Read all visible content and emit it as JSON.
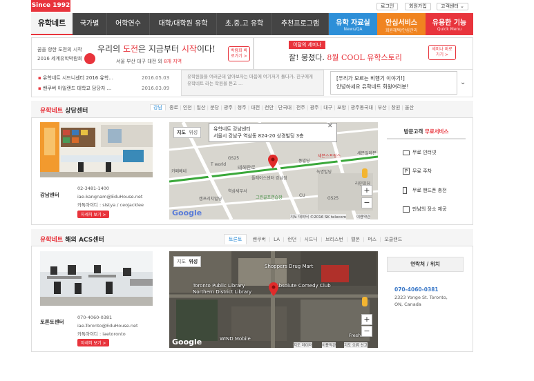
{
  "top": {
    "since": "Since 1992",
    "login": "로그인",
    "join": "회원가입",
    "customer": "고객센터"
  },
  "nav": {
    "logo": "유학네트",
    "items": [
      "국가별",
      "어학연수",
      "대학/대학원 유학",
      "초.중.고 유학",
      "추천프로그램"
    ],
    "special": [
      {
        "title": "유학 자료실",
        "sub": "News/QA",
        "color": "#2d8fd8"
      },
      {
        "title": "안심서비스",
        "sub": "회원혜택/안심관리",
        "color": "#f08420"
      },
      {
        "title": "유용한 기능",
        "sub": "Quick Menu",
        "color": "#e8343c"
      }
    ]
  },
  "banner1": {
    "small1": "꿈을 향한 도전의 시작",
    "small2": "2016 세계유학박람회",
    "headline_pre": "우리의 ",
    "headline_red1": "도전",
    "headline_mid": "은 지금부터 ",
    "headline_red2": "시작",
    "headline_post": "이다!",
    "sub_pre": "서울 부산 대구 대전 외 ",
    "sub_red": "8개 지역",
    "btn": "박람회 바로가기 >"
  },
  "banner2": {
    "tag": "이달의 세미나",
    "headline_pre": "잘! 뭉쳤다. ",
    "headline_red": "8월 COOL 유학스토리",
    "btn": "세미나 바로가기 >"
  },
  "news": [
    {
      "title": "유학네트 시드니센터 2016 유학...",
      "date": "2016.05.03"
    },
    {
      "title": "밴쿠버 아일랜드 대학교 담당자 ...",
      "date": "2016.03.09"
    }
  ],
  "promo": "유학원들을 여러군데 알아보자는 마음에 여기저기 돌다가, 친구에게 유학네트 라는 학원을 듣고 ...",
  "notice": {
    "title": "[우리가 모르는 비행기 이야기!]",
    "body": "안녕하세요 유학네트 회원여러분!"
  },
  "domestic": {
    "title_red": "유학네트",
    "title_rest": " 상담센터",
    "tabs": [
      "강남",
      "종로",
      "인천",
      "일산",
      "분당",
      "광주",
      "청주",
      "대전",
      "천안",
      "단국대",
      "전주",
      "광주",
      "대구",
      "포항",
      "광주동국대",
      "부산",
      "창원",
      "울산"
    ],
    "center": {
      "name": "강남센터",
      "phone": "02-3481-1400",
      "email": "iae-kangnam@EduHouse.net",
      "kakao": "카톡아이디 : sistya / ceojacklee",
      "btn": "자세히 보기 >"
    },
    "map": {
      "tab_map": "지도",
      "tab_sat": "위성",
      "info_title": "유학네트 강남센터",
      "info_addr": "서울시 강남구 역삼동 824-20 상경빌딩 3층",
      "labels": [
        "GS25",
        "T world",
        "카페베네",
        "테헤란로",
        "역삼세무서",
        "그린골프연습장",
        "캠프리치빌딩",
        "퐁빌딩",
        "녹명빌딩",
        "세븐스프링스",
        "플레이스센터 강남점",
        "CU",
        "GS25",
        "라인빌딩",
        "세븐일레븐"
      ],
      "footer": "지도 데이터 ©2016 SK telecom",
      "terms": "이용약관"
    },
    "services_title_pre": "방문고객 ",
    "services_title_red": "무료서비스",
    "services": [
      {
        "icon": "computer-icon",
        "label": "무료 인터넷"
      },
      {
        "icon": "parking-icon",
        "label": "무료 주차"
      },
      {
        "icon": "phone-charge-icon",
        "label": "무료 핸드폰 충전"
      },
      {
        "icon": "meeting-icon",
        "label": "만남의 장소 제공"
      }
    ]
  },
  "overseas": {
    "title_red": "유학네트",
    "title_rest": " 해외 ACS센터",
    "tabs": [
      "토론토",
      "밴쿠버",
      "LA",
      "런던",
      "시드니",
      "브리스번",
      "멜본",
      "퍼스",
      "오클랜드"
    ],
    "center": {
      "name": "토론토센터",
      "phone": "070-4060-0381",
      "email": "iae-Toronto@EduHouse.net",
      "kakao": "카톡아이디 : iaetoronto",
      "btn": "자세히 보기 >"
    },
    "map": {
      "tab_map": "지도",
      "tab_sat": "위성",
      "labels": [
        "Shoppers Drug Mart",
        "Toronto Public Library",
        "Northern District Library",
        "Absolute Comedy Club",
        "WIND Mobile",
        "Freshii"
      ],
      "footer": "지도 데이터",
      "terms": "이용약관",
      "report": "지도 오류 신고"
    },
    "contact_title": "연락처 / 위치",
    "contact_phone": "070-4060-0381",
    "contact_addr1": "2323 Yonge St. Toronto,",
    "contact_addr2": "ON, Canada"
  },
  "google": "Google"
}
